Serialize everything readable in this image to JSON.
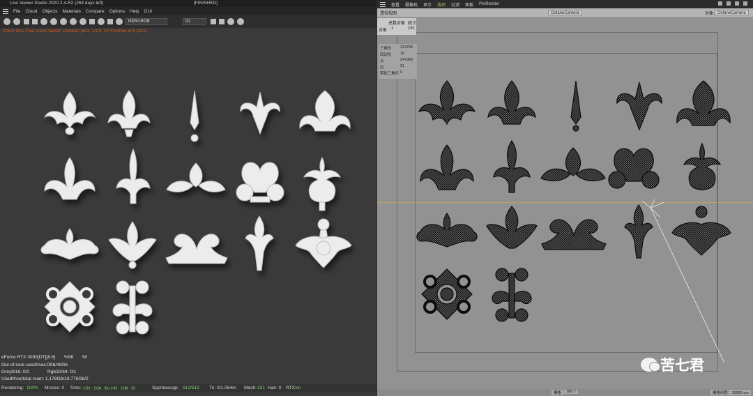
{
  "left": {
    "title": "Live Viewer Studio 2020.2.4-R2 (264 days left)",
    "status": "[FINISHED]",
    "menu": [
      "File",
      "Cloud",
      "Objects",
      "Materials",
      "Compare",
      "Options",
      "Help",
      "GUI"
    ],
    "select_colorspace": "HDR/sRGB",
    "select_mode": "DL",
    "info_line": "Check time: Fast scene loaded; Updated [pass: 1/1/b: 10] Finished at N [2s/1]"
  },
  "stats": {
    "gpu": "eForce RTX 3090[DT][8.6]",
    "gpu_pct": "%96",
    "gpu_num": "50",
    "outofcore": "Out-of-core used/max:0Kb/48Gb",
    "grey": "Grey8/16: 0/0",
    "rgb": "Rgb32/64: 0/1",
    "vram": "Used/free/total vram: 1.178Gb/19.776Gb/2",
    "rendering_label": "Rendering:",
    "rendering_value": "100%",
    "mspersec": "Ms/sec: 0",
    "time_label": "Time:",
    "time_value": "小时 : 分钟 : 秒/小时 : 分钟 : 秒",
    "spp_label": "Spp/maxspp:",
    "spp_value": "512/512",
    "tri": "Tri: 0/1.064m",
    "mesh_label": "Mesh:",
    "mesh_value": "151",
    "hair": "Hair: 0",
    "rtx_label": "RTX:",
    "rtx_value": "on"
  },
  "right": {
    "menu": [
      "查看",
      "摄像机",
      "显示",
      "选项",
      "过滤",
      "面板",
      "ProRender"
    ],
    "active_menu": "选项",
    "view_label": "透视视图",
    "camera_tag": "OctaneCamera",
    "camera_tag2": "OctaneCamera",
    "camera_prefix": "对象：",
    "hud": {
      "col1": "总数对象",
      "col2": "统计",
      "row_label": "对象",
      "row_v1": "1",
      "row_v2": "151"
    },
    "hud2": [
      {
        "k": "三角形",
        "v": "124794"
      },
      {
        "k": "四边形",
        "v": "10"
      },
      {
        "k": "点",
        "v": "247990"
      },
      {
        "k": "边",
        "v": "21"
      },
      {
        "k": "带状三角形",
        "v": "0"
      }
    ],
    "bottom_left": "栅格",
    "bottom_mid": "166.7",
    "bottom_right": "栅格间距：10000 cm",
    "watermark": "苦七君"
  },
  "colors": {
    "accent": "#a6c95b",
    "orange_info": "#d25a1e",
    "viewport": "#929292",
    "stat_green": "#7fd36b"
  }
}
